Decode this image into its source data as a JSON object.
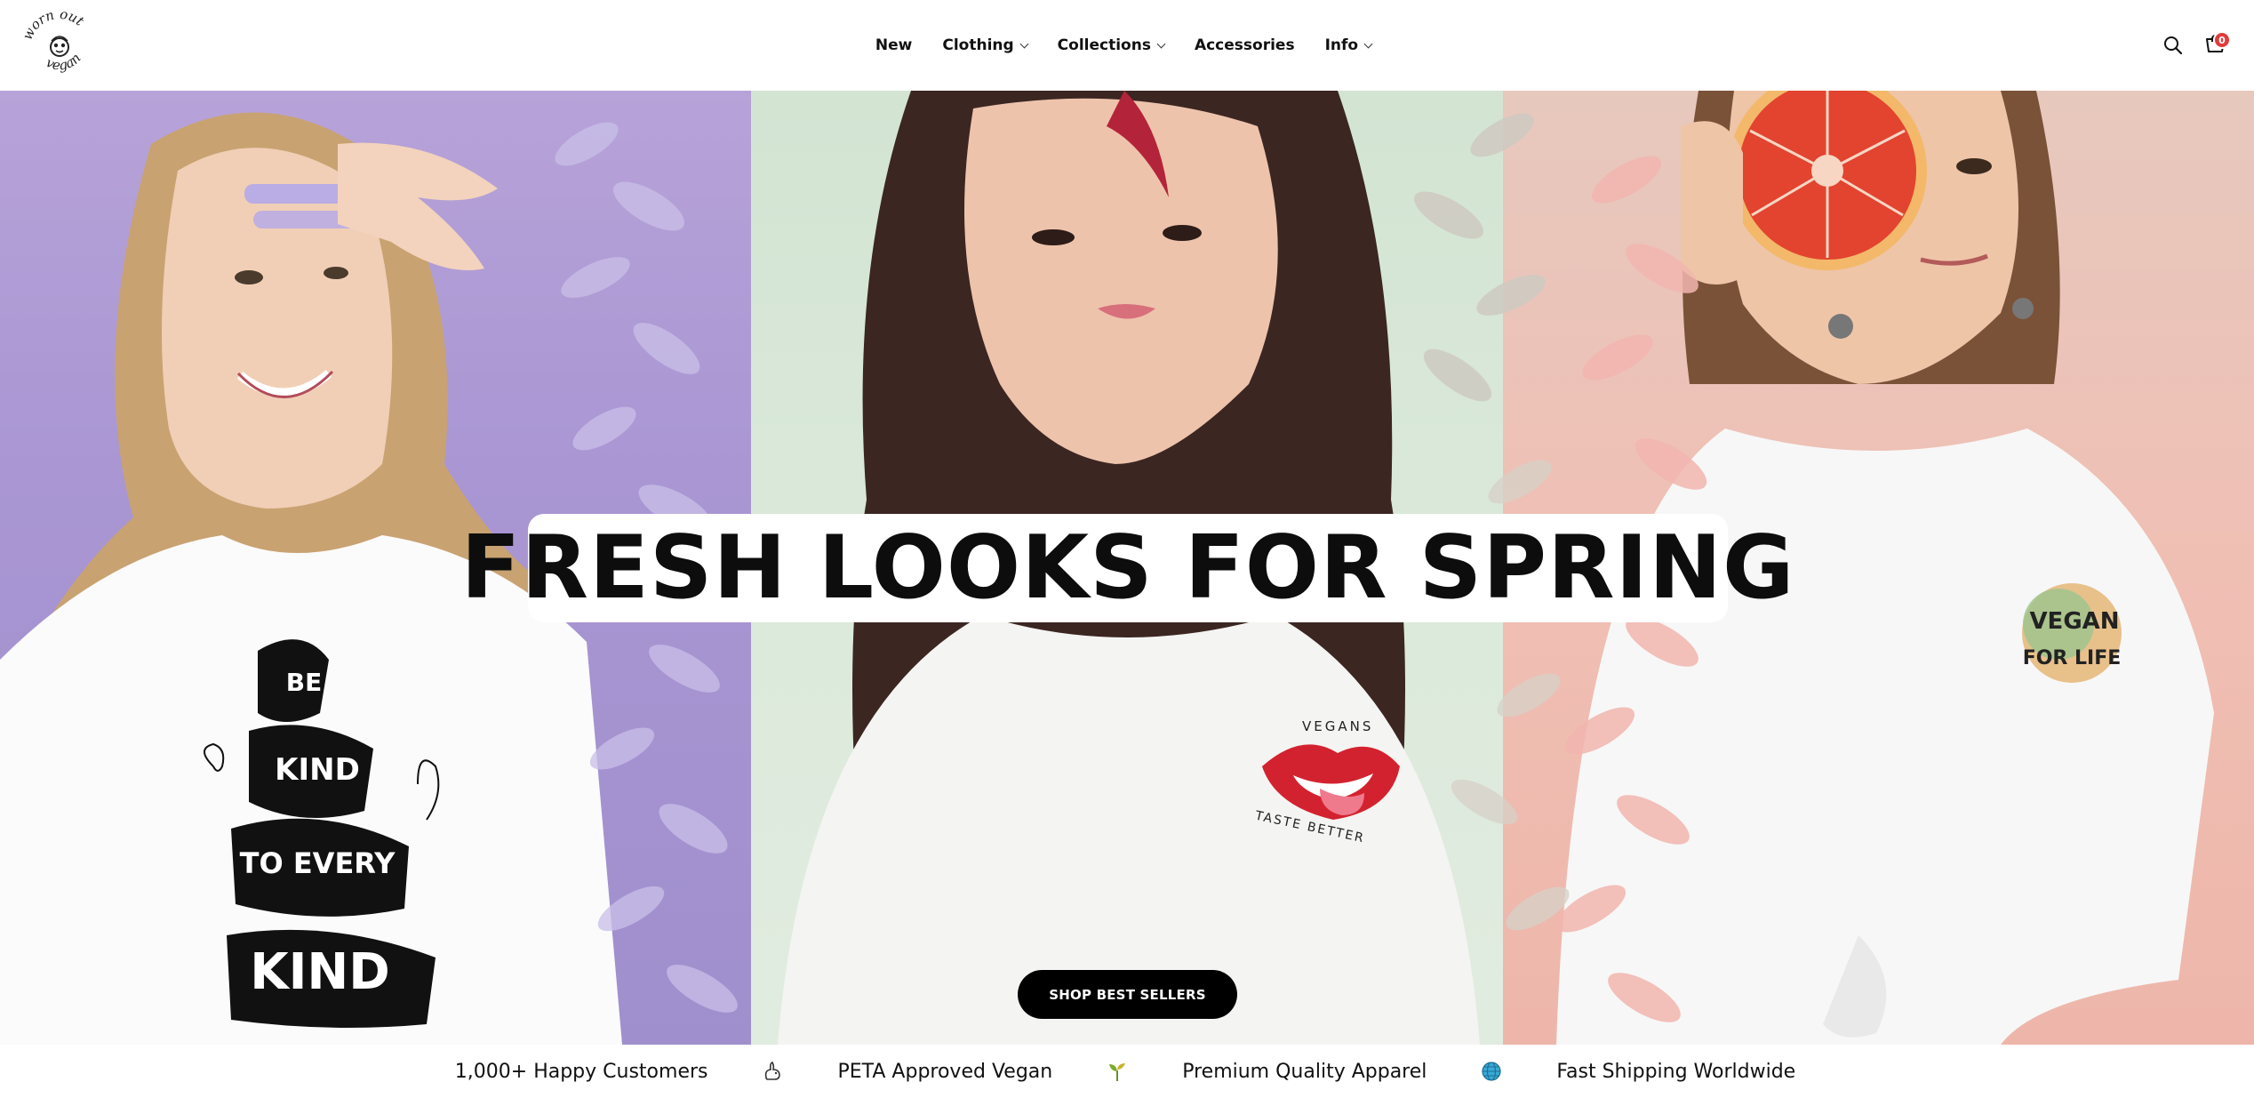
{
  "brand": {
    "logo_text_top": "worn out",
    "logo_text_bottom": "vegan"
  },
  "nav": {
    "items": [
      {
        "label": "New",
        "has_dropdown": false
      },
      {
        "label": "Clothing",
        "has_dropdown": true
      },
      {
        "label": "Collections",
        "has_dropdown": true
      },
      {
        "label": "Accessories",
        "has_dropdown": false
      },
      {
        "label": "Info",
        "has_dropdown": true
      }
    ]
  },
  "header_icons": {
    "search": "search-icon",
    "cart": "cart-icon",
    "cart_count": "0"
  },
  "hero": {
    "headline": "FRESH LOOKS FOR SPRING",
    "cta_label": "SHOP BEST SELLERS",
    "shirt_prints": {
      "left": [
        "BE",
        "KIND",
        "TO EVERY",
        "KIND"
      ],
      "center_top": "VEGANS",
      "center_bottom": "TASTE BETTER",
      "right": [
        "VEGAN",
        "FOR LIFE"
      ]
    }
  },
  "trust_bar": [
    {
      "text": "1,000+ Happy Customers",
      "icon": "rabbit-icon"
    },
    {
      "text": "PETA Approved Vegan",
      "icon": "sprout-icon"
    },
    {
      "text": "Premium Quality Apparel",
      "icon": "globe-icon"
    },
    {
      "text": "Fast Shipping Worldwide",
      "icon": null
    }
  ],
  "colors": {
    "lavender": "#a996d3",
    "mint": "#dbe9da",
    "peach": "#f0bfb4",
    "cart_badge": "#e23b3b",
    "cta_bg": "#000000"
  }
}
